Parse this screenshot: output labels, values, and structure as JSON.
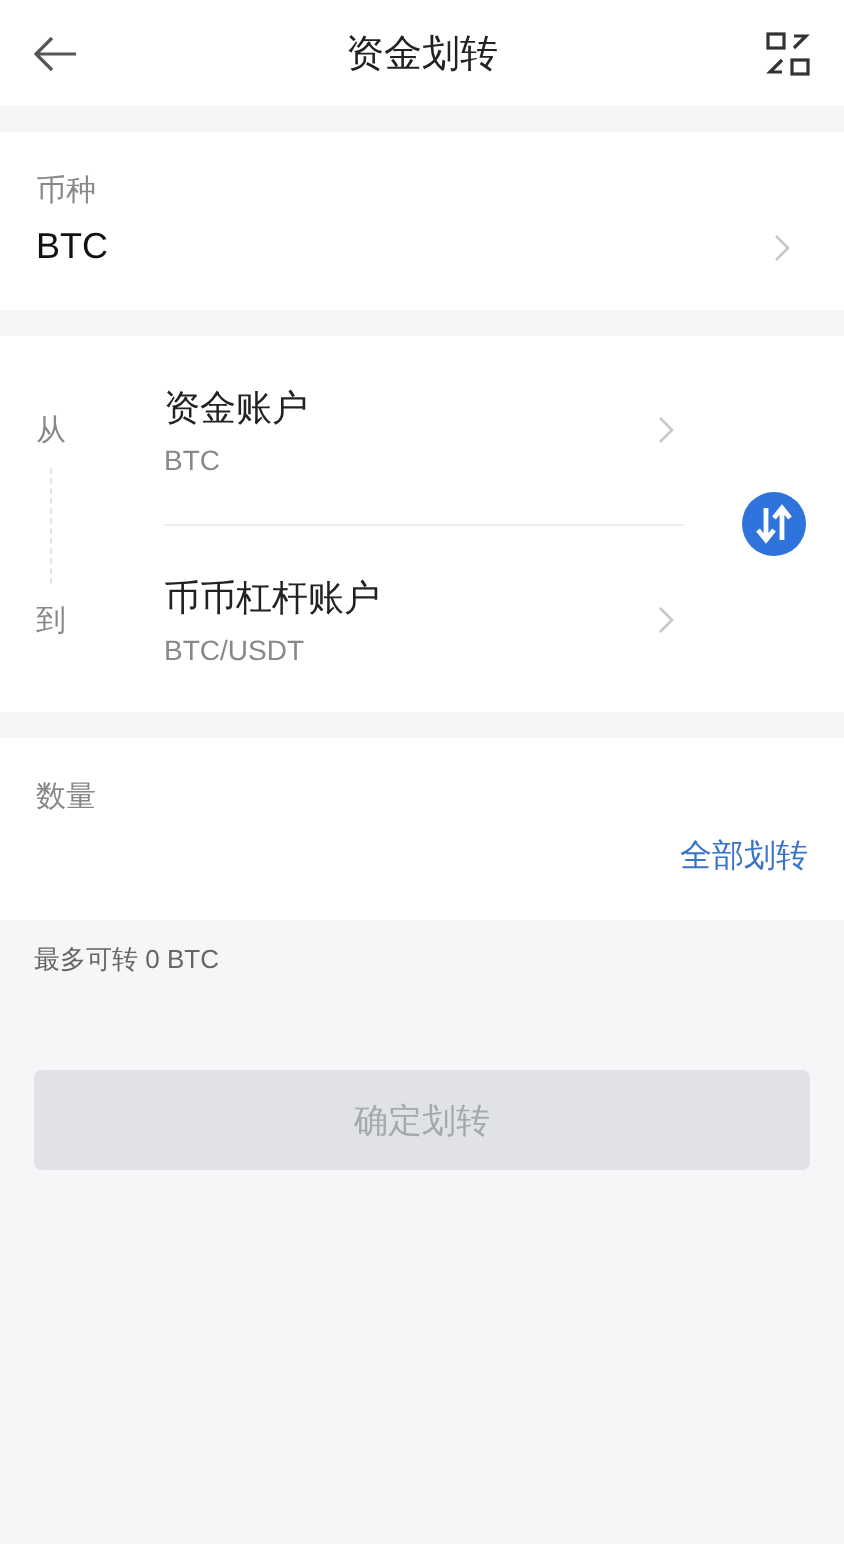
{
  "header": {
    "title": "资金划转"
  },
  "coin": {
    "label": "币种",
    "value": "BTC"
  },
  "transfer": {
    "from_label": "从",
    "to_label": "到",
    "from": {
      "name": "资金账户",
      "detail": "BTC"
    },
    "to": {
      "name": "币币杠杆账户",
      "detail": "BTC/USDT"
    }
  },
  "amount": {
    "label": "数量",
    "all_link": "全部划转"
  },
  "max_note": "最多可转 0 BTC",
  "confirm": {
    "label": "确定划转",
    "disabled": true
  }
}
